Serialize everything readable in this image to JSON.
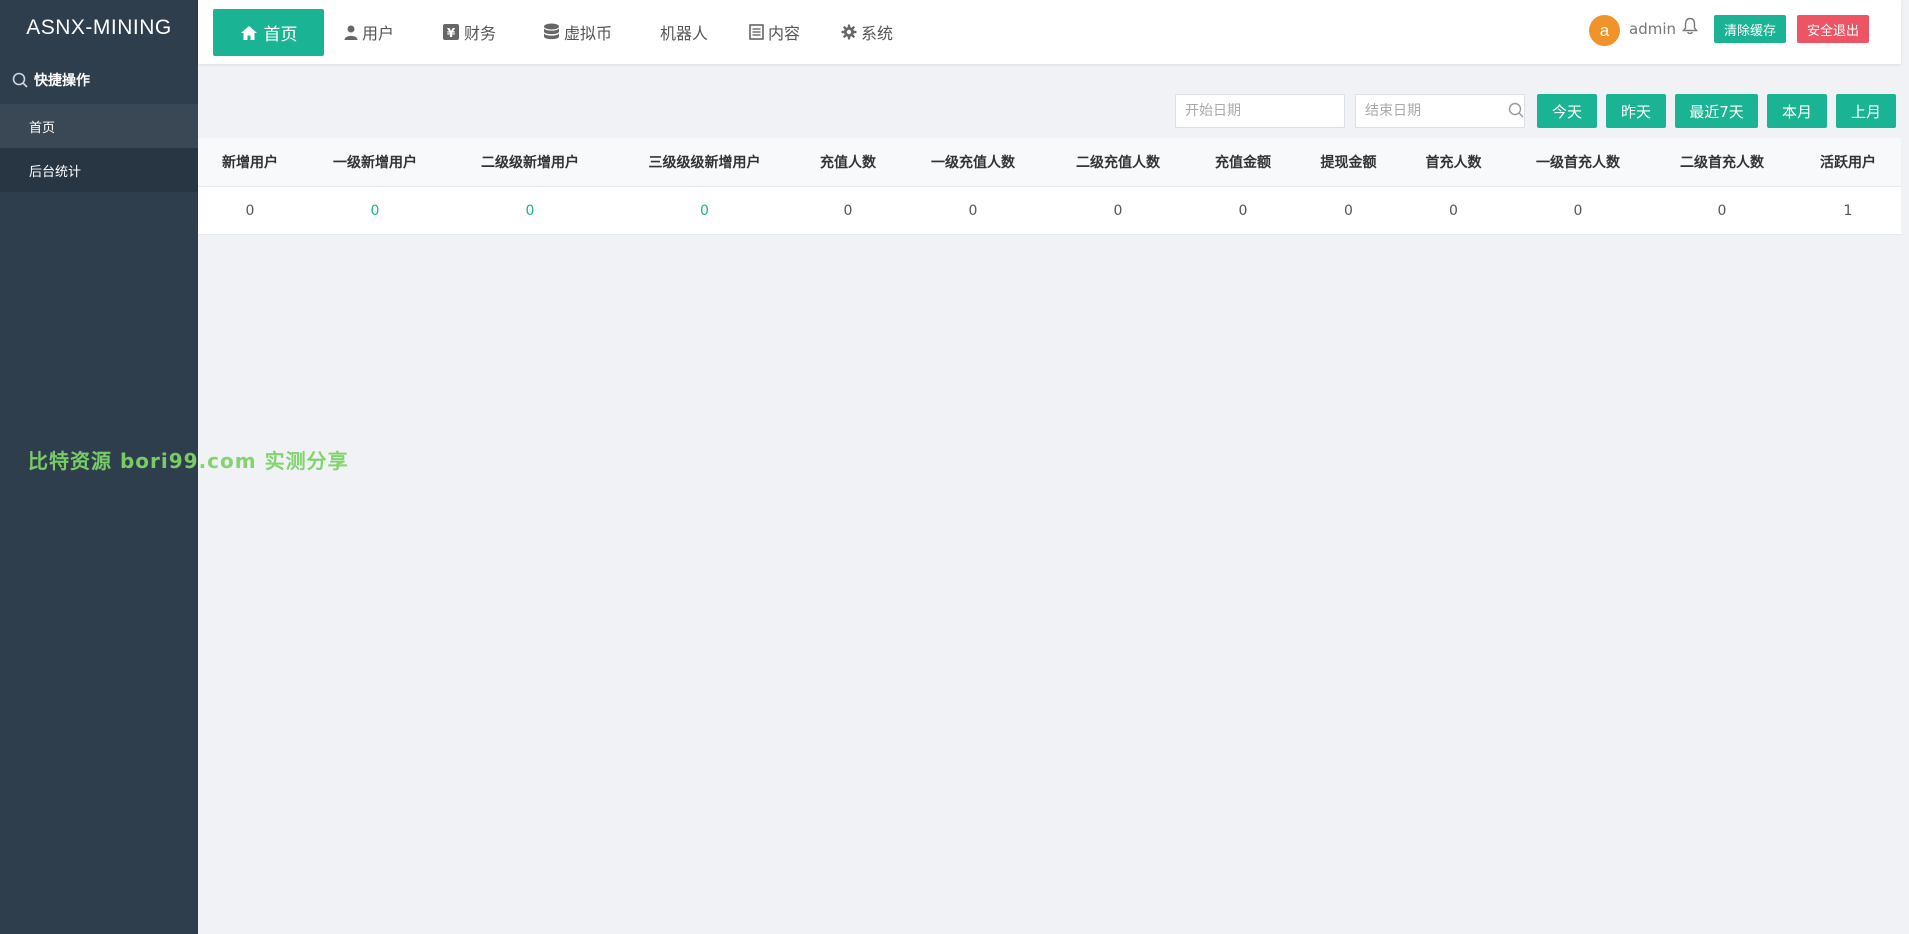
{
  "brand": "ASNX-MINING",
  "sidebar": {
    "quick_label": "快捷操作",
    "items": [
      {
        "label": "首页"
      },
      {
        "label": "后台统计"
      }
    ]
  },
  "nav": {
    "items": [
      {
        "label": "首页",
        "icon": "home-icon"
      },
      {
        "label": "用户",
        "icon": "user-icon"
      },
      {
        "label": "财务",
        "icon": "yen-icon"
      },
      {
        "label": "虚拟币",
        "icon": "database-icon"
      },
      {
        "label": "机器人",
        "icon": "robot-icon"
      },
      {
        "label": "内容",
        "icon": "document-icon"
      },
      {
        "label": "系统",
        "icon": "gear-icon"
      }
    ]
  },
  "user": {
    "avatar_letter": "a",
    "name": "admin",
    "clear_cache": "清除缓存",
    "logout": "安全退出"
  },
  "filters": {
    "start_placeholder": "开始日期",
    "end_placeholder": "结束日期",
    "buttons": [
      "今天",
      "昨天",
      "最近7天",
      "本月",
      "上月"
    ]
  },
  "table": {
    "headers": [
      "新增用户",
      "一级新增用户",
      "二级级新增用户",
      "三级级级新增用户",
      "充值人数",
      "一级充值人数",
      "二级充值人数",
      "充值金额",
      "提现金额",
      "首充人数",
      "一级首充人数",
      "二级首充人数",
      "活跃用户"
    ],
    "row": [
      "0",
      "0",
      "0",
      "0",
      "0",
      "0",
      "0",
      "0",
      "0",
      "0",
      "0",
      "0",
      "1"
    ]
  },
  "colors": {
    "accent": "#1ab394",
    "danger": "#ed5565",
    "sidebar": "#2f3e4d",
    "avatar": "#f0932b"
  },
  "watermark": "比特资源 bori99.com 实测分享"
}
